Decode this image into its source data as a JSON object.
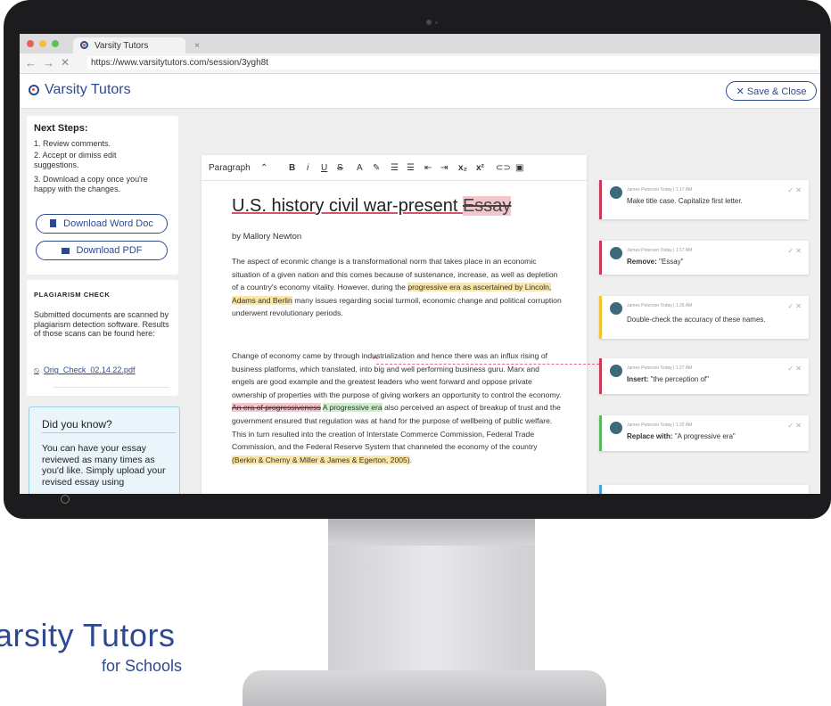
{
  "browser": {
    "tab_title": "Varsity Tutors",
    "tab_close": "×",
    "url": "https://www.varsitytutors.com/session/3ygh8t",
    "nav_back": "←",
    "nav_forward": "→",
    "nav_close": "✕"
  },
  "app": {
    "name": "Varsity Tutors",
    "save_close": "✕  Save & Close"
  },
  "next_steps": {
    "title": "Next Steps:",
    "items": [
      "1. Review comments.",
      "2. Accept or dimiss edit suggestions.",
      "3. Download a copy once you're happy with the changes."
    ],
    "download_word": "Download Word Doc",
    "download_pdf": "Download PDF"
  },
  "plagiarism": {
    "title": "PLAGIARISM CHECK",
    "text": "Submitted documents are scanned by plagiarism detection software. Results of those scans can be found here:",
    "file": "Orig_Check_02.14.22.pdf"
  },
  "did_you_know": {
    "title": "Did you know?",
    "text": "You can have your essay reviewed as many times as you'd like. Simply upload your revised essay using"
  },
  "toolbar": {
    "style": "Paragraph",
    "style_arrow": "⌃",
    "bold": "B",
    "italic": "i",
    "underline": "U",
    "strike": "S",
    "font_color": "A",
    "highlight": "✎",
    "ordered_list": "☰",
    "bullet_list": "☰",
    "outdent": "⇤",
    "indent": "⇥",
    "subscript": "x₂",
    "superscript": "x²",
    "link": "⊂⊃",
    "image": "▣"
  },
  "document": {
    "title_main": "U.S. history civil war-present ",
    "title_deleted": "Essay",
    "byline": "by Mallory Newton",
    "p1_a": "The aspect of econmic change is a transformational norm that takes place in an economic situation of a given nation and this comes because of sustenance, increase, as well as depletion of a country's economy vitality. However, during the ",
    "p1_hl": "progressive era as ascertained by Lincoln, Adams and Berlin",
    "p1_b": " many issues regarding social turmoil, economic change and political corruption underwent revolutionary periods.",
    "p2_a": "Change of economy came by through industrialization and hence there was an influx rising of business platforms, which translated, into big and well performing business guru. Marx and engels are good example and the greatest leaders who went forward and oppose private ownership of properties with the purpose of giving workers an opportunity to control the economy. ",
    "p2_deleted": "An era of progressiveness",
    "p2_space": " ",
    "p2_inserted": "A progressive era",
    "p2_b": " also perceived an aspect of breakup of trust and the government ensured that regulation was at hand for the purpose of wellbeing of public welfare. This in turn resulted into the creation of Interstate Commerce Commission, Federal Trade Commission, and the Federal Reserve System that channeled the economy of the country ",
    "p2_cite": "(Berkin & Cherny & Miller & James & Egerton, 2005)",
    "p2_end": "."
  },
  "comments": [
    {
      "meta": "James Peterson  Today | 1:17 AM",
      "label": "",
      "text": "Make title case. Capitalize first letter.",
      "color": "#c83a58"
    },
    {
      "meta": "James Peterson  Today | 1:17 AM",
      "label": "Remove:",
      "text": " \"Essay\"",
      "color": "#c83a58"
    },
    {
      "meta": "James Peterson  Today | 1:26 AM",
      "label": "",
      "text": "Double-check the accuracy of these names.",
      "color": "#f0c630"
    },
    {
      "meta": "James Peterson  Today | 1:27 AM",
      "label": "Insert:",
      "text": " \"the perception of\"",
      "color": "#c83a58"
    },
    {
      "meta": "James Peterson  Today | 1:32 AM",
      "label": "Replace with:",
      "text": " \"A progressive era\"",
      "color": "#5bb85c"
    }
  ],
  "comment_actions": {
    "accept": "✓",
    "reject": "✕"
  },
  "branding": {
    "line1": "arsity Tutors",
    "line2": "for Schools"
  }
}
